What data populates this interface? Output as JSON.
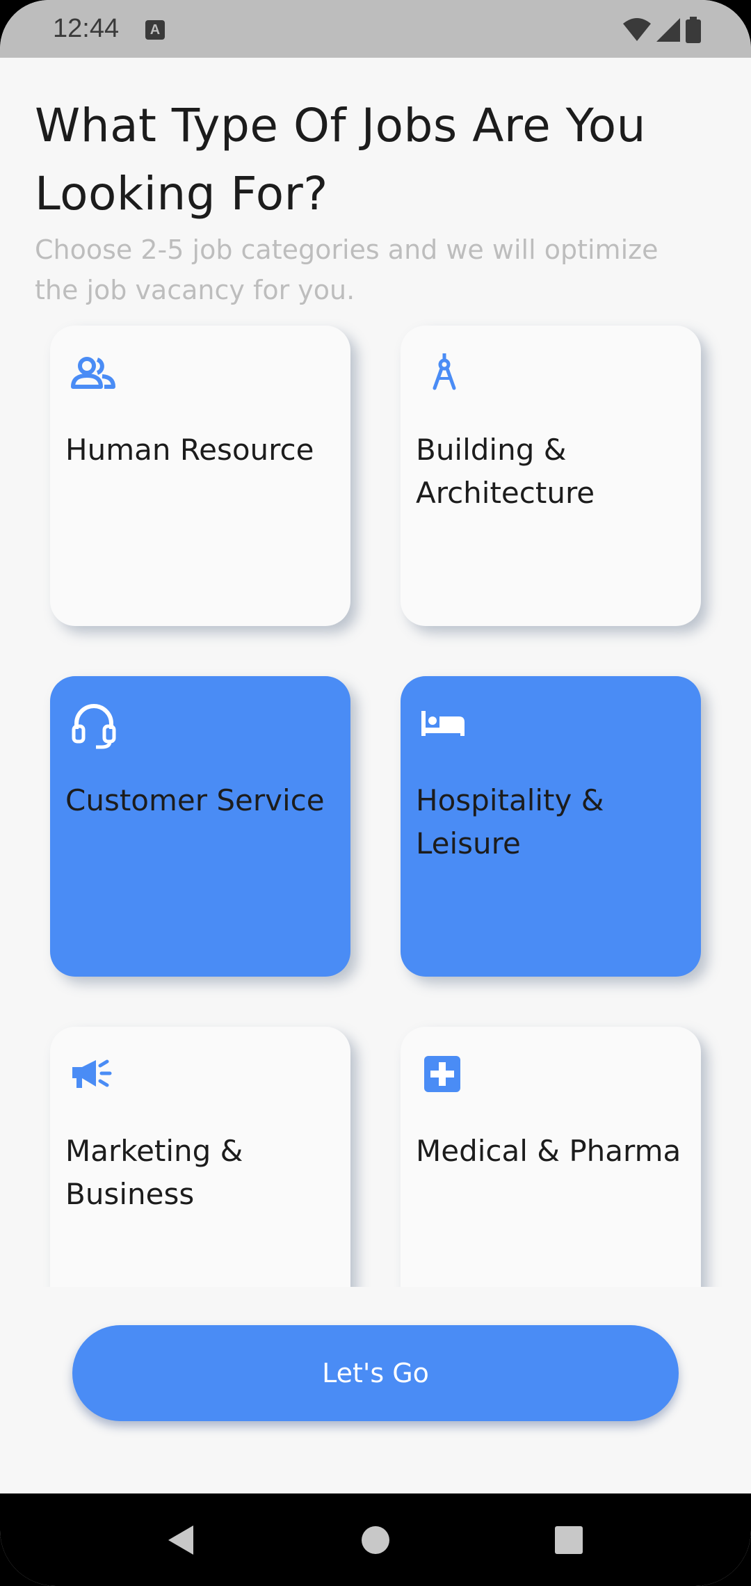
{
  "status_bar": {
    "time": "12:44",
    "notification_icon": "a-icon",
    "icons": [
      "wifi-icon",
      "signal-icon",
      "battery-icon"
    ]
  },
  "header": {
    "title": "What Type Of Jobs Are You Looking For?",
    "subtitle": "Choose 2-5 job categories and we will optimize the job vacancy for you."
  },
  "categories": [
    {
      "label": "Human Resource",
      "icon": "people-icon",
      "selected": false
    },
    {
      "label": "Building & Architecture",
      "icon": "compass-icon",
      "selected": false
    },
    {
      "label": "Customer Service",
      "icon": "headset-icon",
      "selected": true
    },
    {
      "label": "Hospitality & Leisure",
      "icon": "bed-icon",
      "selected": true
    },
    {
      "label": "Marketing & Business",
      "icon": "megaphone-icon",
      "selected": false
    },
    {
      "label": "Medical & Pharma",
      "icon": "medical-cross-icon",
      "selected": false
    }
  ],
  "cta": {
    "label": "Let's Go"
  },
  "nav": {
    "icons": [
      "back-icon",
      "home-icon",
      "recents-icon"
    ]
  },
  "colors": {
    "accent": "#4a8cf5",
    "card": "#fafafa",
    "background": "#f7f7f7",
    "subtitle": "#bdbdbd",
    "text": "#1c1c1c"
  }
}
